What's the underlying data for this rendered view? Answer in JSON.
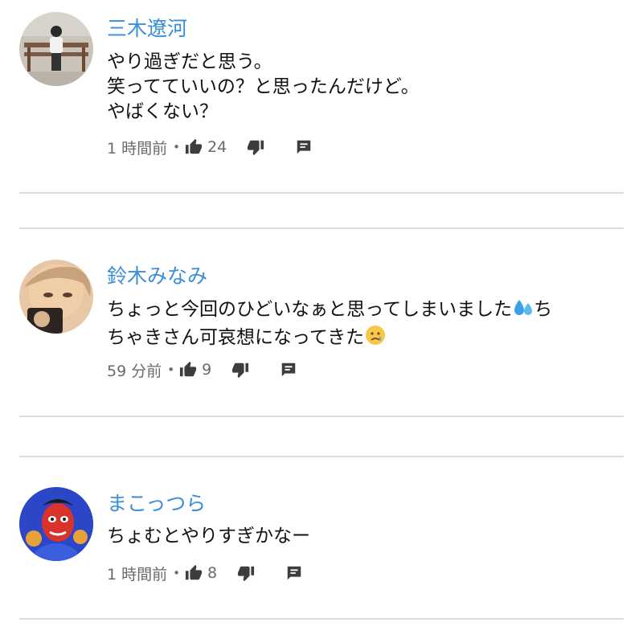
{
  "comments": [
    {
      "author": "三木遼河",
      "text_lines": [
        "やり過ぎだと思う。",
        "笑ってていいの？と思ったんだけど。",
        "やばくない？"
      ],
      "time": "1 時間前",
      "likes": "24",
      "avatar_icon": "avatar-photo-person-on-bench"
    },
    {
      "author": "鈴木みなみ",
      "text_lines": [
        "ちょっと今回のひどいなぁと思ってしまいました",
        "ちゃきさん可哀想になってきた"
      ],
      "time": "59 分前",
      "likes": "9",
      "avatar_icon": "avatar-photo-woman-face",
      "emojis": [
        "sweat-droplets-emoji",
        "sad-face-emoji"
      ]
    },
    {
      "author": "まこっつら",
      "text_lines": [
        "ちょむとやりすぎかなー"
      ],
      "time": "1 時間前",
      "likes": "8",
      "avatar_icon": "avatar-cartoon-genie"
    }
  ],
  "separator": "•",
  "icons": [
    "thumbs-up-icon",
    "thumbs-down-icon",
    "reply-icon"
  ],
  "colors": {
    "author": "#3b8ed9",
    "text": "#111111",
    "meta": "#6a6a6a",
    "divider": "#dedede"
  }
}
